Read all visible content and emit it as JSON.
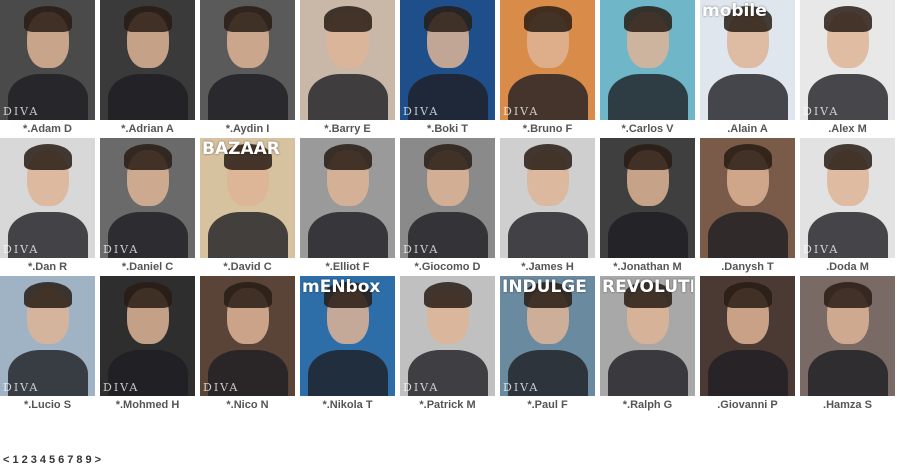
{
  "models": [
    {
      "name": "*.Adam D",
      "bg": "#4a4a4a",
      "watermark": "DIVA"
    },
    {
      "name": "*.Adrian A",
      "bg": "#3a3a3a",
      "watermark": ""
    },
    {
      "name": "*.Aydin I",
      "bg": "#5a5a5a",
      "watermark": ""
    },
    {
      "name": "*.Barry E",
      "bg": "#c9b8a8",
      "watermark": ""
    },
    {
      "name": "*.Boki T",
      "bg": "#1e4f8a",
      "watermark": "DIVA"
    },
    {
      "name": "*.Bruno F",
      "bg": "#d98b4a",
      "watermark": "DIVA"
    },
    {
      "name": "*.Carlos V",
      "bg": "#6fb6c9",
      "watermark": ""
    },
    {
      "name": ".Alain A",
      "bg": "#dfe6ee",
      "watermark": "",
      "magazine": "mobile"
    },
    {
      "name": ".Alex M",
      "bg": "#e8e8e8",
      "watermark": "DIVA"
    },
    {
      "name": "*.Dan R",
      "bg": "#d8d8d8",
      "watermark": "DIVA"
    },
    {
      "name": "*.Daniel C",
      "bg": "#6a6a6a",
      "watermark": "DIVA"
    },
    {
      "name": "*.David C",
      "bg": "#d7c2a0",
      "watermark": "",
      "magazine": "BAZAAR"
    },
    {
      "name": "*.Elliot F",
      "bg": "#9a9a9a",
      "watermark": ""
    },
    {
      "name": "*.Giocomo D",
      "bg": "#8a8a8a",
      "watermark": "DIVA"
    },
    {
      "name": "*.James H",
      "bg": "#cfcfcf",
      "watermark": ""
    },
    {
      "name": "*.Jonathan M",
      "bg": "#3f3f3f",
      "watermark": ""
    },
    {
      "name": ".Danysh T",
      "bg": "#7a5a48",
      "watermark": ""
    },
    {
      "name": ".Doda M",
      "bg": "#e2e2e2",
      "watermark": "DIVA"
    },
    {
      "name": "*.Lucio S",
      "bg": "#9fb3c4",
      "watermark": "DIVA"
    },
    {
      "name": "*.Mohmed H",
      "bg": "#2e2e2e",
      "watermark": "DIVA"
    },
    {
      "name": "*.Nico N",
      "bg": "#5a4438",
      "watermark": "DIVA"
    },
    {
      "name": "*.Nikola T",
      "bg": "#2e6ea8",
      "watermark": "",
      "magazine": "mENbox"
    },
    {
      "name": "*.Patrick M",
      "bg": "#c0c0c0",
      "watermark": "DIVA"
    },
    {
      "name": "*.Paul F",
      "bg": "#6a8aa0",
      "watermark": "DIVA",
      "magazine": "INDULGE"
    },
    {
      "name": "*.Ralph G",
      "bg": "#a8a8a8",
      "watermark": "",
      "magazine": "REVOLUTION"
    },
    {
      "name": ".Giovanni P",
      "bg": "#4a3a33",
      "watermark": ""
    },
    {
      "name": ".Hamza S",
      "bg": "#7a6a66",
      "watermark": ""
    }
  ],
  "pagination": {
    "prev": "<",
    "pages": [
      "1",
      "2",
      "3",
      "4",
      "5",
      "6",
      "7",
      "8",
      "9"
    ],
    "next": ">"
  }
}
